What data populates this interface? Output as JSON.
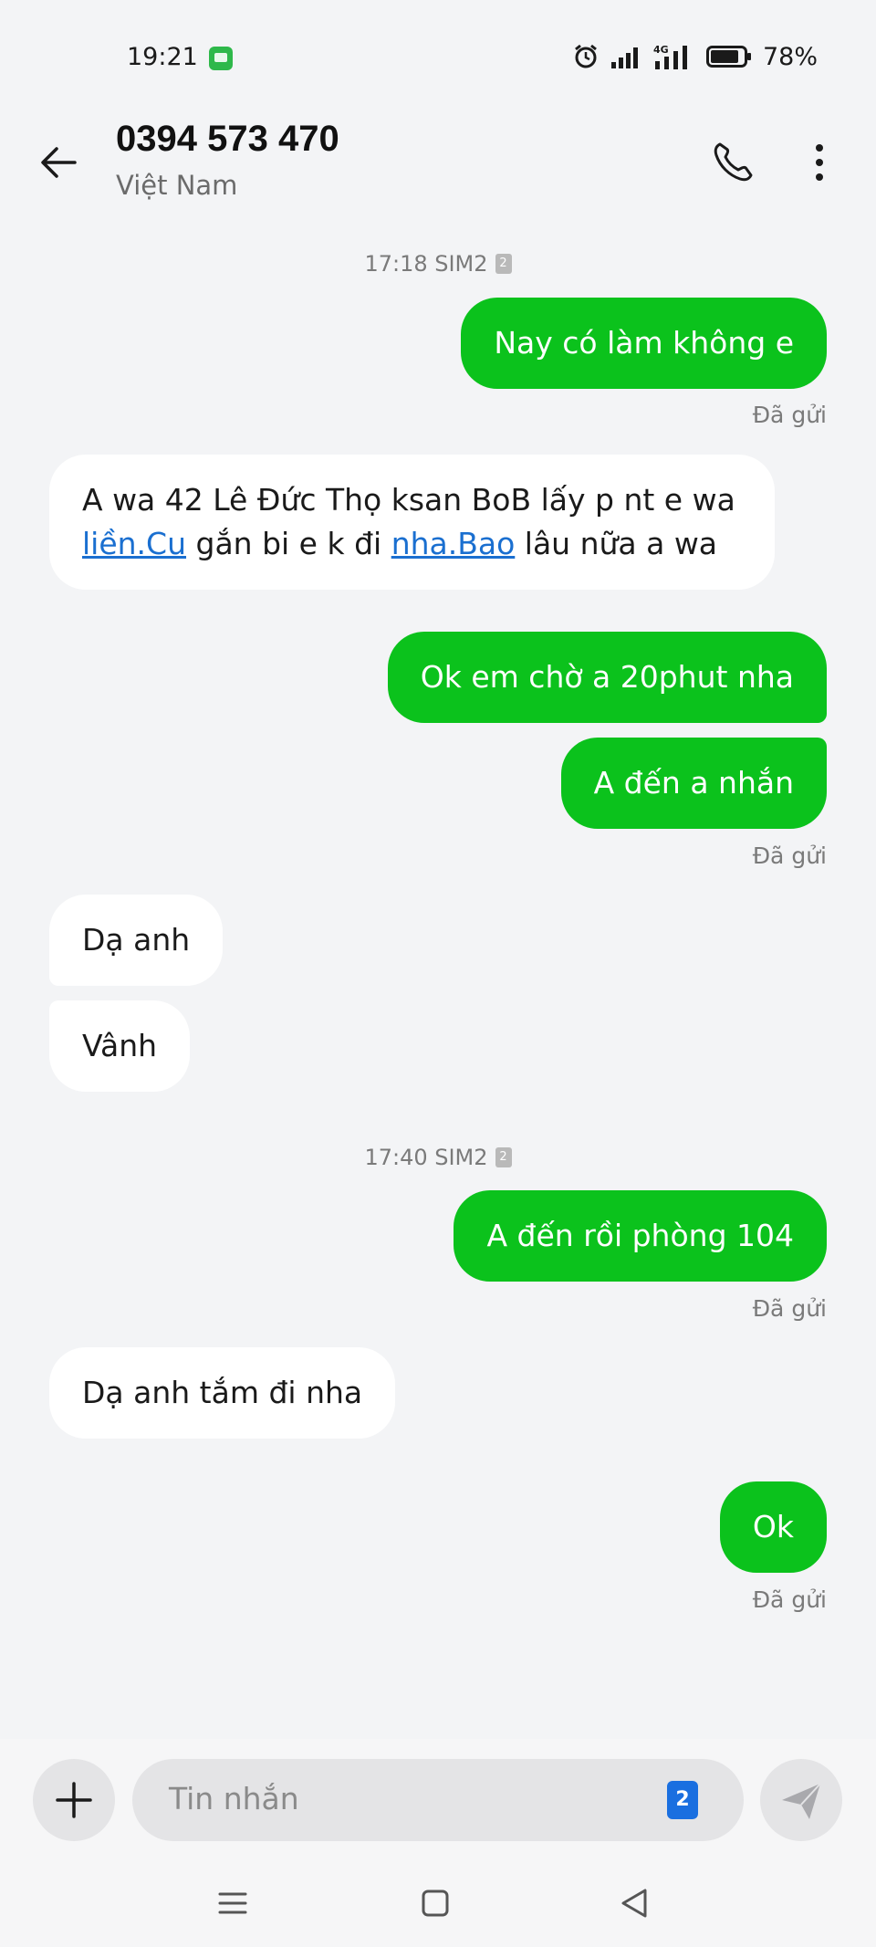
{
  "status_bar": {
    "time": "19:21",
    "network": "4G",
    "battery": "78%"
  },
  "header": {
    "title": "0394 573 470",
    "subtitle": "Việt Nam"
  },
  "thread": {
    "ts1": {
      "time": "17:18 SIM2",
      "sim": "2"
    },
    "m1": "Nay có làm không e",
    "sent1": "Đã gửi",
    "m2": {
      "part1": "A wa 42 Lê Đức Thọ ksan BoB lấy p nt e wa",
      "link1": "liền.Cu",
      "part2": " gắn bi e k đi ",
      "link2": "nha.Bao",
      "part3": " lâu nữa a wa"
    },
    "m3": "Ok em chờ a 20phut nha",
    "m4": "A đến a nhắn",
    "sent2": "Đã gửi",
    "m5": "Dạ anh",
    "m6": "Vânh",
    "ts2": {
      "time": "17:40 SIM2",
      "sim": "2"
    },
    "m7": "A đến rồi phòng 104",
    "sent3": "Đã gửi",
    "m8": "Dạ anh tắm đi nha",
    "m9": "Ok",
    "sent4": "Đã gửi"
  },
  "composer": {
    "placeholder": "Tin nhắn",
    "sim_label": "2"
  },
  "colors": {
    "outgoing_bubble": "#0bc21c",
    "incoming_bubble": "#ffffff",
    "link": "#1a6fd0"
  },
  "icons": [
    "back-arrow-icon",
    "phone-icon",
    "more-vert-icon",
    "plus-icon",
    "send-icon",
    "menu-icon",
    "home-icon",
    "back-nav-icon"
  ]
}
